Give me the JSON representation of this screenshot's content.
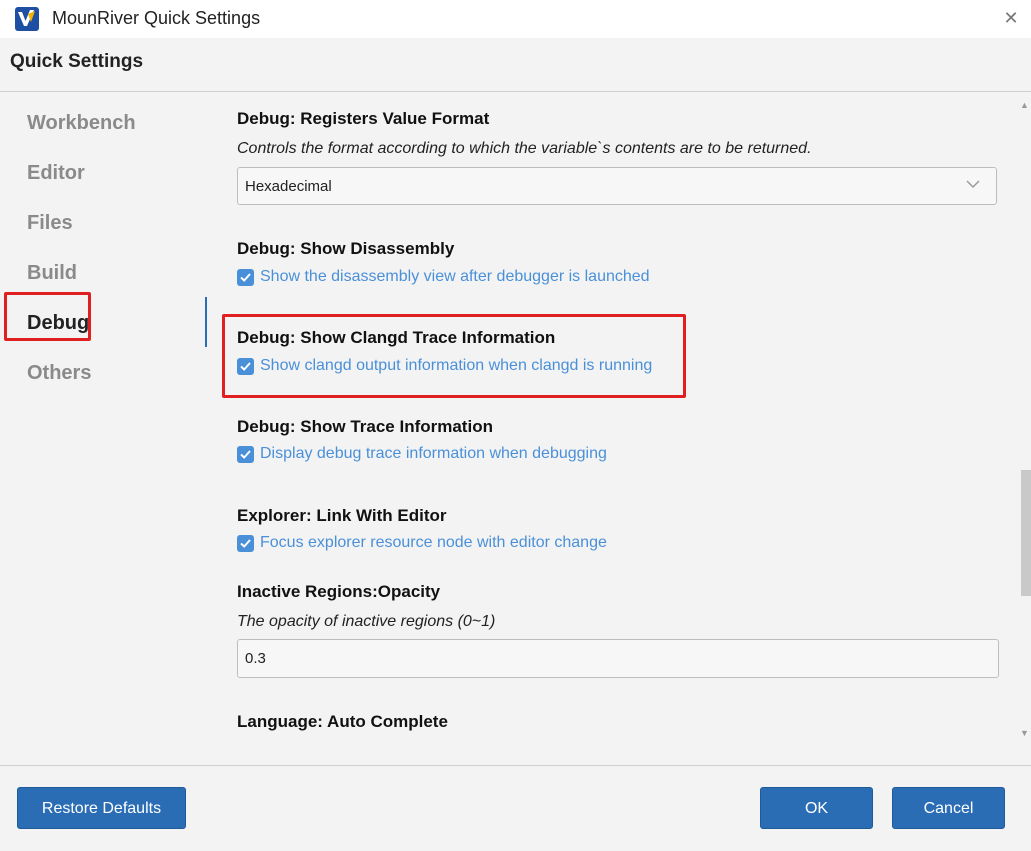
{
  "window": {
    "title": "MounRiver Quick Settings",
    "close_glyph": "✕"
  },
  "header": {
    "title": "Quick Settings"
  },
  "sidebar": {
    "items": [
      {
        "label": "Workbench"
      },
      {
        "label": "Editor"
      },
      {
        "label": "Files"
      },
      {
        "label": "Build"
      },
      {
        "label": "Debug",
        "active": true
      },
      {
        "label": "Others"
      }
    ]
  },
  "settings": {
    "registers_format": {
      "title": "Debug: Registers Value Format",
      "description": "Controls the format according to which the variable`s contents are to be returned.",
      "value": "Hexadecimal"
    },
    "show_disassembly": {
      "title": "Debug: Show Disassembly",
      "checkbox_label": "Show the disassembly view after debugger is launched",
      "checked": true
    },
    "clangd_trace": {
      "title": "Debug: Show Clangd Trace Information",
      "checkbox_label": "Show clangd output information when clangd is running",
      "checked": true
    },
    "trace_info": {
      "title": "Debug: Show Trace Information",
      "checkbox_label": "Display debug trace information when debugging",
      "checked": true
    },
    "link_editor": {
      "title": "Explorer: Link With Editor",
      "checkbox_label": "Focus explorer resource node with editor change",
      "checked": true
    },
    "inactive_opacity": {
      "title": "Inactive Regions:Opacity",
      "description": "The opacity of inactive regions (0~1)",
      "value": "0.3"
    },
    "auto_complete": {
      "title": "Language: Auto Complete"
    }
  },
  "footer": {
    "restore_label": "Restore Defaults",
    "ok_label": "OK",
    "cancel_label": "Cancel"
  },
  "colors": {
    "accent": "#2a6db5",
    "checkbox": "#4a90d9",
    "highlight": "#e02020"
  }
}
